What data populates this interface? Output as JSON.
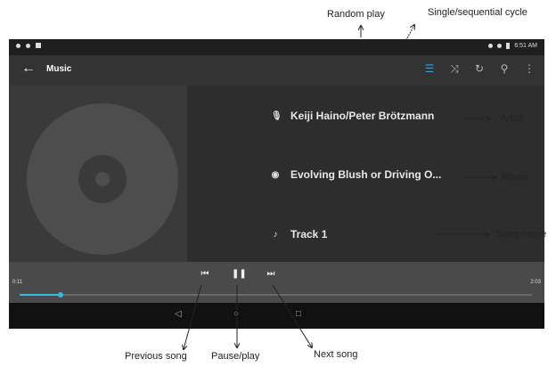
{
  "status_bar": {
    "time": "6:51 AM"
  },
  "app_bar": {
    "back_glyph": "←",
    "title": "Music",
    "actions": [
      "queue-icon",
      "shuffle-icon",
      "repeat-icon",
      "search-icon",
      "overflow-menu-icon"
    ]
  },
  "now_playing": {
    "artist": "Keiji Haino/Peter Brötzmann",
    "album": "Evolving Blush or Driving O...",
    "song": "Track 1"
  },
  "player": {
    "elapsed": "0:11",
    "duration": "2:03",
    "progress_fraction": 0.08,
    "prev_glyph": "⏮",
    "pause_glyph": "❚❚",
    "next_glyph": "⏭"
  },
  "nav_bar": {
    "back": "◁",
    "home": "○",
    "recents": "□"
  },
  "annotations": {
    "random_play": "Random play",
    "cycle": "Single/sequential cycle",
    "artist": "Artist",
    "album": "Album",
    "song_name": "Song name",
    "previous": "Previous song",
    "pause_play": "Pause/play",
    "next": "Next song"
  },
  "colors": {
    "accent": "#29a0e0",
    "progress": "#3fb5e0",
    "background": "#2d2d2d"
  }
}
